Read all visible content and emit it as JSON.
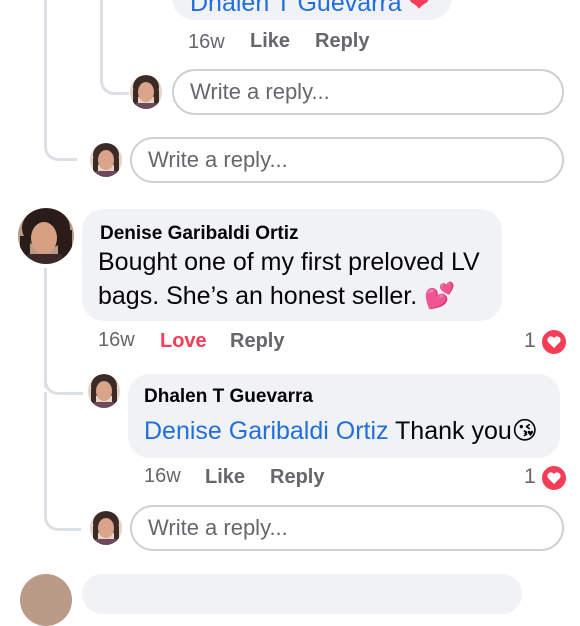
{
  "top_comment_fragment": {
    "text": "Dhalen T Guevarra",
    "time": "16w",
    "like_label": "Like",
    "reply_label": "Reply"
  },
  "reply_box_1": {
    "placeholder": "Write a reply..."
  },
  "reply_box_2": {
    "placeholder": "Write a reply..."
  },
  "comment": {
    "author": "Denise Garibaldi Ortiz",
    "text": "Bought one of my first preloved LV bags. She’s an honest seller.",
    "emoji": "💕",
    "time": "16w",
    "reaction_label": "Love",
    "reply_label": "Reply",
    "reaction_count": "1",
    "reaction_icon": "heart-icon"
  },
  "reply": {
    "author": "Dhalen T Guevarra",
    "mention": "Denise Garibaldi Ortiz",
    "text": "Thank you",
    "emoji": "😘",
    "time": "16w",
    "like_label": "Like",
    "reply_label": "Reply",
    "reaction_count": "1",
    "reaction_icon": "heart-icon"
  },
  "reply_box_3": {
    "placeholder": "Write a reply..."
  },
  "colors": {
    "love": "#f33e58",
    "mention": "#216fdb",
    "bubble": "#f0f2f5",
    "thread_line": "#dcdfe3"
  }
}
